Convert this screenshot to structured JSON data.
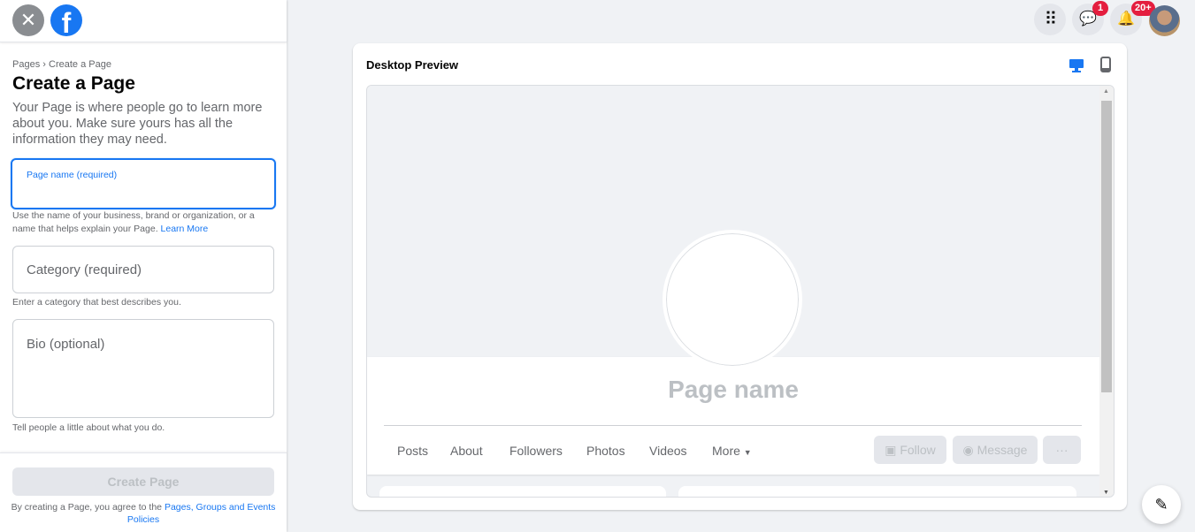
{
  "sidebar": {
    "close_icon": "close-icon",
    "logo": "facebook-logo",
    "breadcrumb": {
      "parent": "Pages",
      "separator": "›",
      "current": "Create a Page"
    },
    "title": "Create a Page",
    "description": "Your Page is where people go to learn more about you. Make sure yours has all the information they may need.",
    "page_name": {
      "label": "Page name (required)",
      "value": "",
      "hint": "Use the name of your business, brand or organization, or a name that helps explain your Page.",
      "learn_more": "Learn More"
    },
    "category": {
      "placeholder": "Category (required)",
      "hint": "Enter a category that best describes you."
    },
    "bio": {
      "placeholder": "Bio (optional)",
      "hint": "Tell people a little about what you do."
    },
    "create_button": "Create Page",
    "terms_prefix": "By creating a Page, you agree to the",
    "terms_link": "Pages, Groups and Events Policies"
  },
  "topbar": {
    "menu_icon": "grid-icon",
    "messenger_badge": "1",
    "notifications_badge": "20+"
  },
  "preview": {
    "title": "Desktop Preview",
    "active_mode": "desktop",
    "page_name": "Page name",
    "tabs": [
      "Posts",
      "About",
      "Followers",
      "Photos",
      "Videos",
      "More"
    ],
    "buttons": {
      "follow": "Follow",
      "message": "Message",
      "more": "···"
    }
  },
  "colors": {
    "accent": "#1877f2",
    "badge": "#e41e3f"
  }
}
